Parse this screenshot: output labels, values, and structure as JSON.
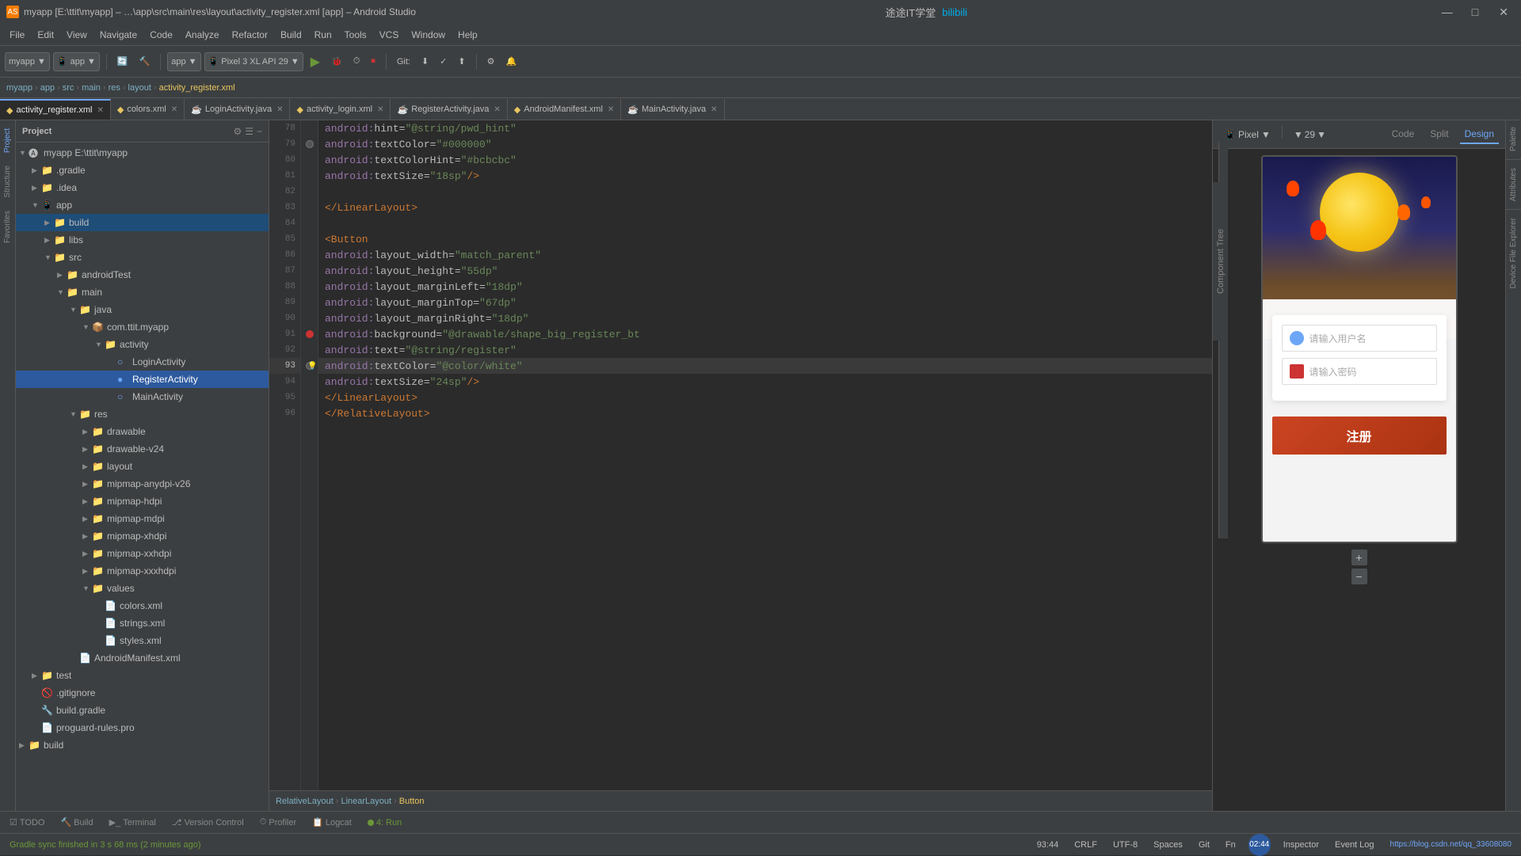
{
  "titleBar": {
    "appName": "myapp",
    "projectPath": "E:\\ttit\\myapp",
    "fileName": "activity_register.xml",
    "ideTitle": "Android Studio",
    "fullTitle": "myapp [E:\\ttit\\myapp] – …\\app\\src\\main\\res\\layout\\activity_register.xml [app] – Android Studio",
    "windowControls": {
      "minimize": "—",
      "maximize": "□",
      "close": "✕"
    }
  },
  "menuBar": {
    "items": [
      "File",
      "Edit",
      "View",
      "Navigate",
      "Code",
      "Analyze",
      "Refactor",
      "Build",
      "Run",
      "Tools",
      "VCS",
      "Window",
      "Help"
    ]
  },
  "toolbar": {
    "projectDropdown": "myapp",
    "appDropdown": "app",
    "runConfigDropdown": "app",
    "deviceDropdown": "Pixel 3 XL API 29",
    "gitLabel": "Git:"
  },
  "breadcrumb": {
    "items": [
      "myapp",
      "app",
      "src",
      "main",
      "res",
      "layout",
      "activity_register.xml"
    ]
  },
  "tabs": [
    {
      "label": "activity_register.xml",
      "active": true,
      "icon": "xml"
    },
    {
      "label": "colors.xml",
      "active": false,
      "icon": "xml"
    },
    {
      "label": "LoginActivity.java",
      "active": false,
      "icon": "java"
    },
    {
      "label": "activity_login.xml",
      "active": false,
      "icon": "xml"
    },
    {
      "label": "RegisterActivity.java",
      "active": false,
      "icon": "java"
    },
    {
      "label": "AndroidManifest.xml",
      "active": false,
      "icon": "xml"
    },
    {
      "label": "MainActivity.java",
      "active": false,
      "icon": "java"
    }
  ],
  "sidebar": {
    "title": "Project",
    "tree": [
      {
        "level": 0,
        "label": "myapp E:\\ttit\\myapp",
        "type": "project",
        "expanded": true,
        "icon": "📁"
      },
      {
        "level": 1,
        "label": ".gradle",
        "type": "folder",
        "expanded": false,
        "icon": "📁"
      },
      {
        "level": 1,
        "label": ".idea",
        "type": "folder",
        "expanded": false,
        "icon": "📁"
      },
      {
        "level": 1,
        "label": "app",
        "type": "folder",
        "expanded": true,
        "icon": "📁"
      },
      {
        "level": 2,
        "label": "build",
        "type": "folder",
        "expanded": false,
        "icon": "📁",
        "highlight": true
      },
      {
        "level": 2,
        "label": "libs",
        "type": "folder",
        "expanded": false,
        "icon": "📁"
      },
      {
        "level": 2,
        "label": "src",
        "type": "folder",
        "expanded": true,
        "icon": "📁"
      },
      {
        "level": 3,
        "label": "androidTest",
        "type": "folder",
        "expanded": false,
        "icon": "📁"
      },
      {
        "level": 3,
        "label": "main",
        "type": "folder",
        "expanded": true,
        "icon": "📁"
      },
      {
        "level": 4,
        "label": "java",
        "type": "folder",
        "expanded": true,
        "icon": "📁"
      },
      {
        "level": 5,
        "label": "com.ttit.myapp",
        "type": "package",
        "expanded": true,
        "icon": "📦"
      },
      {
        "level": 6,
        "label": "activity",
        "type": "folder",
        "expanded": true,
        "icon": "📁"
      },
      {
        "level": 7,
        "label": "LoginActivity",
        "type": "java",
        "expanded": false,
        "icon": "☕"
      },
      {
        "level": 7,
        "label": "RegisterActivity",
        "type": "java-active",
        "expanded": false,
        "icon": "☕",
        "selected": true
      },
      {
        "level": 7,
        "label": "MainActivity",
        "type": "java",
        "expanded": false,
        "icon": "☕"
      },
      {
        "level": 4,
        "label": "res",
        "type": "folder",
        "expanded": true,
        "icon": "📁"
      },
      {
        "level": 5,
        "label": "drawable",
        "type": "folder",
        "expanded": false,
        "icon": "📁"
      },
      {
        "level": 5,
        "label": "drawable-v24",
        "type": "folder",
        "expanded": false,
        "icon": "📁"
      },
      {
        "level": 5,
        "label": "layout",
        "type": "folder",
        "expanded": false,
        "icon": "📁"
      },
      {
        "level": 5,
        "label": "mipmap-anydpi-v26",
        "type": "folder",
        "expanded": false,
        "icon": "📁"
      },
      {
        "level": 5,
        "label": "mipmap-hdpi",
        "type": "folder",
        "expanded": false,
        "icon": "📁"
      },
      {
        "level": 5,
        "label": "mipmap-mdpi",
        "type": "folder",
        "expanded": false,
        "icon": "📁"
      },
      {
        "level": 5,
        "label": "mipmap-xhdpi",
        "type": "folder",
        "expanded": false,
        "icon": "📁"
      },
      {
        "level": 5,
        "label": "mipmap-xxhdpi",
        "type": "folder",
        "expanded": false,
        "icon": "📁"
      },
      {
        "level": 5,
        "label": "mipmap-xxxhdpi",
        "type": "folder",
        "expanded": false,
        "icon": "📁"
      },
      {
        "level": 5,
        "label": "values",
        "type": "folder",
        "expanded": true,
        "icon": "📁"
      },
      {
        "level": 6,
        "label": "colors.xml",
        "type": "xml",
        "expanded": false,
        "icon": "📄"
      },
      {
        "level": 6,
        "label": "strings.xml",
        "type": "xml",
        "expanded": false,
        "icon": "📄"
      },
      {
        "level": 6,
        "label": "styles.xml",
        "type": "xml",
        "expanded": false,
        "icon": "📄"
      },
      {
        "level": 4,
        "label": "AndroidManifest.xml",
        "type": "xml",
        "expanded": false,
        "icon": "📄"
      },
      {
        "level": 1,
        "label": "test",
        "type": "folder",
        "expanded": false,
        "icon": "📁"
      },
      {
        "level": 1,
        "label": ".gitignore",
        "type": "file",
        "expanded": false,
        "icon": "📄"
      },
      {
        "level": 1,
        "label": "build.gradle",
        "type": "gradle",
        "expanded": false,
        "icon": "🔧"
      },
      {
        "level": 1,
        "label": "proguard-rules.pro",
        "type": "file",
        "expanded": false,
        "icon": "📄"
      },
      {
        "level": 0,
        "label": "build",
        "type": "folder",
        "expanded": false,
        "icon": "📁"
      }
    ]
  },
  "codeEditor": {
    "lines": [
      {
        "num": 78,
        "code": "            android:hint=\"@string/pwd_hint\"",
        "type": "normal"
      },
      {
        "num": 79,
        "code": "            android:textColor=\"#000000\"",
        "type": "normal"
      },
      {
        "num": 80,
        "code": "            android:textColorHint=\"#bcbcbc\"",
        "type": "normal"
      },
      {
        "num": 81,
        "code": "            android:textSize=\"18sp\" />",
        "type": "normal"
      },
      {
        "num": 82,
        "code": "",
        "type": "normal"
      },
      {
        "num": 83,
        "code": "    </LinearLayout>",
        "type": "normal"
      },
      {
        "num": 84,
        "code": "",
        "type": "normal"
      },
      {
        "num": 85,
        "code": "    <Button",
        "type": "normal"
      },
      {
        "num": 86,
        "code": "        android:layout_width=\"match_parent\"",
        "type": "normal"
      },
      {
        "num": 87,
        "code": "        android:layout_height=\"55dp\"",
        "type": "normal"
      },
      {
        "num": 88,
        "code": "        android:layout_marginLeft=\"18dp\"",
        "type": "normal"
      },
      {
        "num": 89,
        "code": "        android:layout_marginTop=\"67dp\"",
        "type": "normal"
      },
      {
        "num": 90,
        "code": "        android:layout_marginRight=\"18dp\"",
        "type": "normal"
      },
      {
        "num": 91,
        "code": "        android:background=\"@drawable/shape_big_register_bt",
        "type": "normal"
      },
      {
        "num": 92,
        "code": "        android:text=\"@string/register\"",
        "type": "normal"
      },
      {
        "num": 93,
        "code": "        android:textColor=\"@color/white\"",
        "type": "current"
      },
      {
        "num": 94,
        "code": "        android:textSize=\"24sp\" />",
        "type": "normal"
      },
      {
        "num": 95,
        "code": "    </LinearLayout>",
        "type": "normal"
      },
      {
        "num": 96,
        "code": "</RelativeLayout>",
        "type": "normal"
      }
    ],
    "margins": [
      {
        "line": 78,
        "type": "empty"
      },
      {
        "line": 79,
        "type": "dark-square"
      },
      {
        "line": 80,
        "type": "empty"
      },
      {
        "line": 81,
        "type": "empty"
      },
      {
        "line": 82,
        "type": "empty"
      },
      {
        "line": 83,
        "type": "empty"
      },
      {
        "line": 84,
        "type": "empty"
      },
      {
        "line": 85,
        "type": "empty"
      },
      {
        "line": 86,
        "type": "empty"
      },
      {
        "line": 87,
        "type": "empty"
      },
      {
        "line": 88,
        "type": "empty"
      },
      {
        "line": 89,
        "type": "empty"
      },
      {
        "line": 90,
        "type": "empty"
      },
      {
        "line": 91,
        "type": "red-square"
      },
      {
        "line": 92,
        "type": "empty"
      },
      {
        "line": 93,
        "type": "dark-square-hint"
      },
      {
        "line": 94,
        "type": "empty"
      },
      {
        "line": 95,
        "type": "empty"
      },
      {
        "line": 96,
        "type": "empty"
      }
    ]
  },
  "rightPanel": {
    "tabs": [
      "Code",
      "Split",
      "Design"
    ],
    "activeTab": "Code",
    "previewDevice": "Pixel",
    "apiLevel": "29",
    "formFields": {
      "usernamePlaceholder": "请输入用户名",
      "passwordPlaceholder": "请输入密码"
    },
    "registerButton": "注册"
  },
  "bottomTabs": [
    {
      "label": "TODO",
      "icon": ""
    },
    {
      "label": "Build",
      "icon": "🔨"
    },
    {
      "label": "Terminal",
      "icon": ""
    },
    {
      "label": "Version Control",
      "icon": ""
    },
    {
      "label": "Profiler",
      "icon": ""
    },
    {
      "label": "Logcat",
      "icon": ""
    },
    {
      "label": "Run",
      "icon": "▶",
      "number": "4"
    }
  ],
  "statusBar": {
    "gradleStatus": "Gradle sync finished in 3 s 68 ms (2 minutes ago)",
    "lineCol": "93:44",
    "encoding": "CRLF  UTF-8",
    "spaces": "Spaces  Git",
    "fnKey": "Fn",
    "inspectorLabel": "Inspector",
    "eventLogLabel": "Event Log",
    "timeLabel": "02:44",
    "gitBranch": "Git",
    "helpUrl": "https://blog.csdn.net/qq_33608080"
  },
  "breadcrumbBottom": {
    "items": [
      "RelativeLayout",
      "LinearLayout",
      "Button"
    ]
  }
}
